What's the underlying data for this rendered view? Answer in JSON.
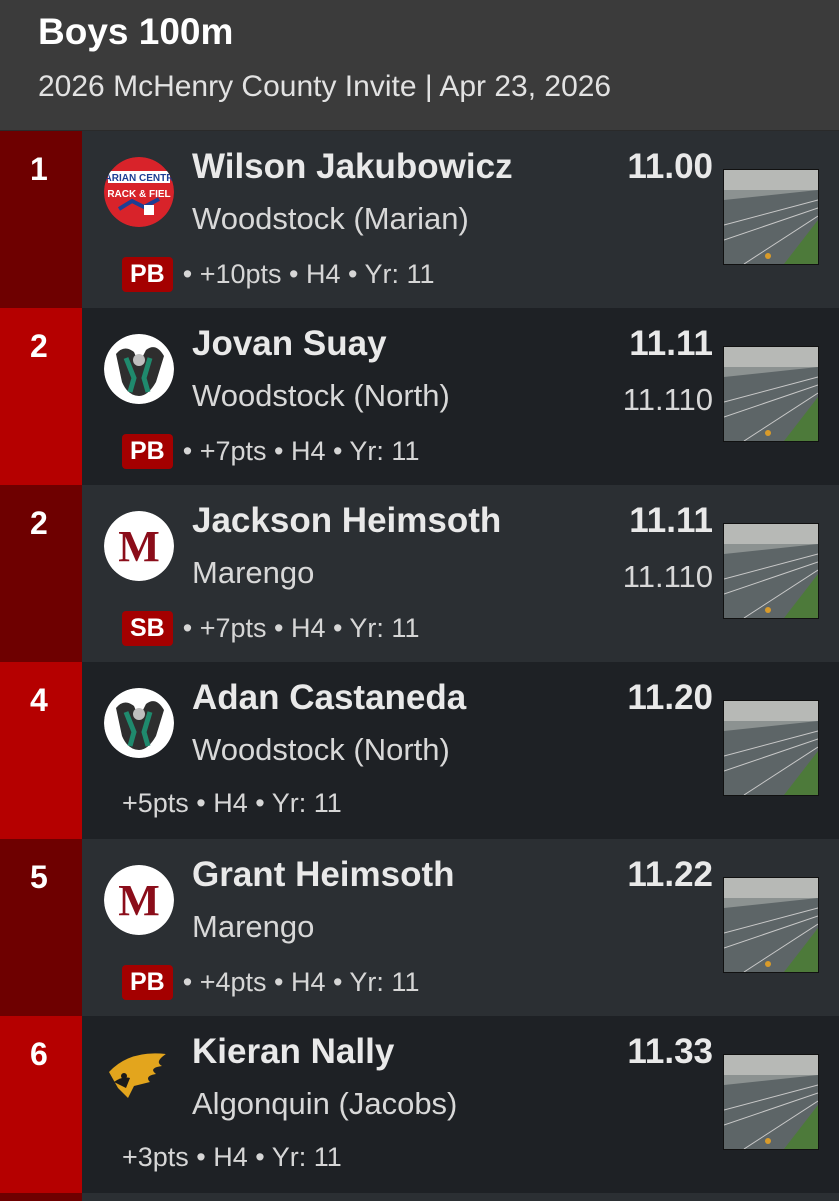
{
  "header": {
    "title": "Boys 100m",
    "subtitle": "2026 McHenry County Invite | Apr 23, 2026"
  },
  "results": [
    {
      "place": "1",
      "name": "Wilson Jakubowicz",
      "school": "Woodstock (Marian)",
      "time": "11.00",
      "time_detail": "",
      "badge": "PB",
      "meta": "• +10pts • H4 • Yr: 11",
      "logo": "marian-central-logo"
    },
    {
      "place": "2",
      "name": "Jovan Suay",
      "school": "Woodstock (North)",
      "time": "11.11",
      "time_detail": "11.110",
      "badge": "PB",
      "meta": "• +7pts • H4 • Yr: 11",
      "logo": "woodstock-north-logo"
    },
    {
      "place": "2",
      "name": "Jackson Heimsoth",
      "school": "Marengo",
      "time": "11.11",
      "time_detail": "11.110",
      "badge": "SB",
      "meta": "• +7pts • H4 • Yr: 11",
      "logo": "marengo-logo"
    },
    {
      "place": "4",
      "name": "Adan Castaneda",
      "school": "Woodstock (North)",
      "time": "11.20",
      "time_detail": "",
      "badge": "",
      "meta": "+5pts • H4 • Yr: 11",
      "logo": "woodstock-north-logo"
    },
    {
      "place": "5",
      "name": "Grant Heimsoth",
      "school": "Marengo",
      "time": "11.22",
      "time_detail": "",
      "badge": "PB",
      "meta": "• +4pts • H4 • Yr: 11",
      "logo": "marengo-logo"
    },
    {
      "place": "6",
      "name": "Kieran Nally",
      "school": "Algonquin (Jacobs)",
      "time": "11.33",
      "time_detail": "",
      "badge": "",
      "meta": "+3pts • H4 • Yr: 11",
      "logo": "jacobs-logo"
    }
  ],
  "logo_text": {
    "marian_line1": "ARIAN CENTR",
    "marian_line2": "RACK & FIEL",
    "marengo_letter": "M"
  },
  "colors": {
    "place_dark": "#6e0000",
    "place_bright": "#b50000",
    "badge": "#a40000",
    "header_bg": "#3b3b3b"
  }
}
